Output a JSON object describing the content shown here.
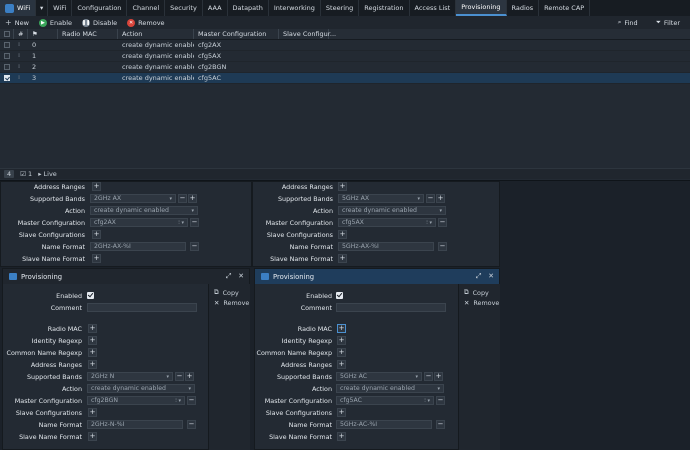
{
  "tabs": [
    {
      "label": "WiFi",
      "icon": "wifi-logo"
    },
    {
      "label": "▾"
    },
    {
      "label": "WiFi"
    },
    {
      "label": "Configuration"
    },
    {
      "label": "Channel"
    },
    {
      "label": "Security"
    },
    {
      "label": "AAA"
    },
    {
      "label": "Datapath"
    },
    {
      "label": "Interworking"
    },
    {
      "label": "Steering"
    },
    {
      "label": "Registration"
    },
    {
      "label": "Access List"
    },
    {
      "label": "Provisioning",
      "active": true
    },
    {
      "label": "Radios"
    },
    {
      "label": "Remote CAP"
    }
  ],
  "toolbar": {
    "new_label": "New",
    "enable_label": "Enable",
    "disable_label": "Disable",
    "remove_label": "Remove",
    "find_label": "Find",
    "filter_label": "Filter"
  },
  "table": {
    "columns": [
      "#",
      "Radio MAC",
      "Action",
      "Master Configuration",
      "Slave Configur..."
    ],
    "rows": [
      {
        "num": "0",
        "radio_mac": "",
        "action": "create dynamic enabled",
        "master": "cfg2AX",
        "slave": "",
        "selected": false
      },
      {
        "num": "1",
        "radio_mac": "",
        "action": "create dynamic enabled",
        "master": "cfg5AX",
        "slave": "",
        "selected": false
      },
      {
        "num": "2",
        "radio_mac": "",
        "action": "create dynamic enabled",
        "master": "cfg2BGN",
        "slave": "",
        "selected": false
      },
      {
        "num": "3",
        "radio_mac": "",
        "action": "create dynamic enabled",
        "master": "cfg5AC",
        "slave": "",
        "selected": true
      }
    ]
  },
  "status": {
    "count": "4",
    "selected": "1",
    "mode": "Live"
  },
  "labels": {
    "address_ranges": "Address Ranges",
    "supported_bands": "Supported Bands",
    "action": "Action",
    "master_configuration": "Master Configuration",
    "slave_configurations": "Slave Configurations",
    "name_format": "Name Format",
    "slave_name_format": "Slave Name Format",
    "enabled": "Enabled",
    "comment": "Comment",
    "radio_mac": "Radio MAC",
    "identity_regexp": "Identity Regexp",
    "common_name_regexp": "Common Name Regexp"
  },
  "panel_top_left": {
    "bands": "2GHz AX",
    "action": "create dynamic enabled",
    "master": "cfg2AX",
    "name_format": "2GHz-AX-%I"
  },
  "panel_top_right": {
    "bands": "5GHz AX",
    "action": "create dynamic enabled",
    "master": "cfg5AX",
    "name_format": "5GHz-AX-%I"
  },
  "panel_bottom_left": {
    "title": "Provisioning",
    "bands": "2GHz N",
    "action": "create dynamic enabled",
    "master": "cfg2BGN",
    "name_format": "2GHz-N-%I"
  },
  "panel_bottom_right": {
    "title": "Provisioning",
    "bands": "5GHz AC",
    "action": "create dynamic enabled",
    "master": "cfg5AC",
    "name_format": "5GHz-AC-%I"
  },
  "side": {
    "copy_label": "Copy",
    "remove_label": "Remove"
  },
  "colors": {
    "accent": "#4b90d0",
    "selected_row": "#1e3a55",
    "enable": "#3aa55a",
    "remove": "#d8443a"
  }
}
